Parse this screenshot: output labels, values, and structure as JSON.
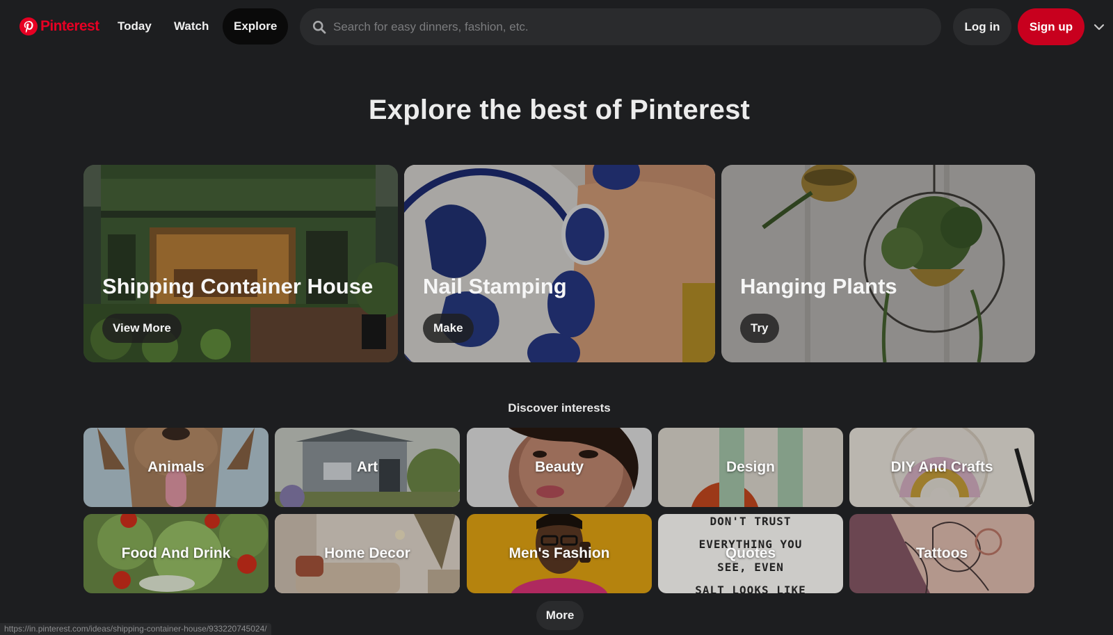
{
  "brand": {
    "name": "Pinterest",
    "color": "#e60023"
  },
  "nav": {
    "items": [
      {
        "label": "Today"
      },
      {
        "label": "Watch"
      },
      {
        "label": "Explore",
        "active": true
      }
    ]
  },
  "search": {
    "placeholder": "Search for easy dinners, fashion, etc.",
    "value": ""
  },
  "auth": {
    "login_label": "Log in",
    "signup_label": "Sign up",
    "signup_color": "#c8001e"
  },
  "hero": {
    "title": "Explore the best of Pinterest"
  },
  "features": [
    {
      "title": "Shipping Container House",
      "button": "View More"
    },
    {
      "title": "Nail Stamping",
      "button": "Make"
    },
    {
      "title": "Hanging Plants",
      "button": "Try"
    }
  ],
  "discover": {
    "label": "Discover interests",
    "tiles": [
      "Animals",
      "Art",
      "Beauty",
      "Design",
      "DIY And Crafts",
      "Food And Drink",
      "Home Decor",
      "Men's Fashion",
      "Quotes",
      "Tattoos"
    ],
    "quotes_text": [
      "DON'T TRUST",
      "EVERYTHING YOU",
      "SEE, EVEN",
      "SALT LOOKS LIKE"
    ],
    "more_label": "More"
  },
  "status_bar": {
    "url": "https://in.pinterest.com/ideas/shipping-container-house/933220745024/"
  }
}
